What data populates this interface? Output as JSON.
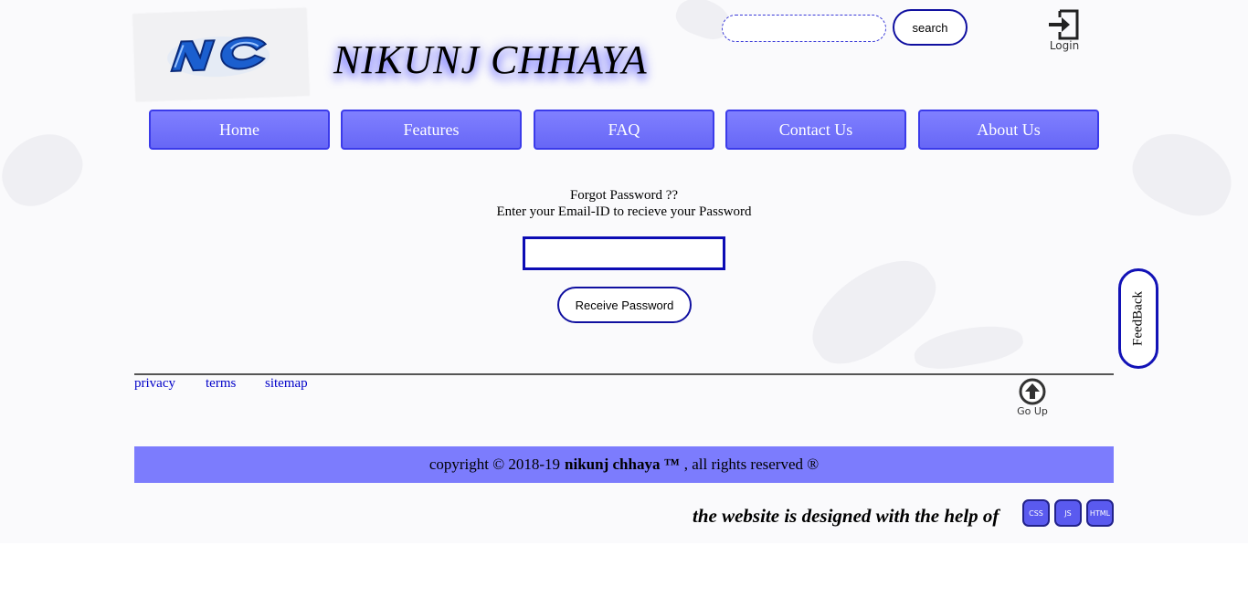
{
  "header": {
    "site_title": "NIKUNJ CHHAYA",
    "logo_text": "NC",
    "search_placeholder": "",
    "search_label": "search",
    "login_label": "Login"
  },
  "nav": [
    {
      "label": "Home"
    },
    {
      "label": "Features"
    },
    {
      "label": "FAQ"
    },
    {
      "label": "Contact Us"
    },
    {
      "label": "About Us"
    }
  ],
  "forgot": {
    "title": "Forgot Password ??",
    "subtitle": "Enter your Email-ID to recieve your Password",
    "email_value": "",
    "button_label": "Receive Password"
  },
  "feedback": {
    "label": "FeedBack"
  },
  "footer": {
    "links": [
      "privacy",
      "terms",
      "sitemap"
    ],
    "goup_label": "Go Up",
    "copyright_prefix": "copyright © 2018-19",
    "copyright_brand": "nikunj chhaya ™",
    "copyright_suffix": ", all rights reserved ®",
    "credit_text": "the website is designed with the help of",
    "badges": [
      "CSS",
      "JS",
      "HTML"
    ]
  },
  "colors": {
    "nav_fill": "#7070fb",
    "nav_border": "#3b3bea",
    "accent_border": "#1010a0",
    "copyright_bar": "#7c7cfd",
    "link": "#0000c8"
  }
}
